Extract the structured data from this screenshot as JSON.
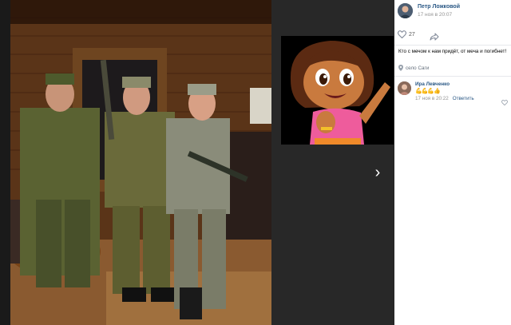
{
  "post": {
    "author": "Петр Ложковой",
    "date": "17 ноя в 20:07",
    "likes": "27",
    "caption": "Кто с мечом к нам придёт, от меча и погибнет!",
    "location": "село Саги"
  },
  "comment": {
    "author": "Ира Левченко",
    "emoji": "💪💪💪👍",
    "date": "17 ноя в 20:22",
    "reply_label": "Ответить"
  },
  "viewer": {
    "next_arrow": "›"
  },
  "colors": {
    "link": "#2a5885",
    "meta": "#939393",
    "panel": "#ffffff",
    "viewer_bg": "#262626"
  },
  "icons": [
    "heart-icon",
    "share-icon",
    "location-pin-icon",
    "next-arrow-icon",
    "comment-like-icon"
  ]
}
